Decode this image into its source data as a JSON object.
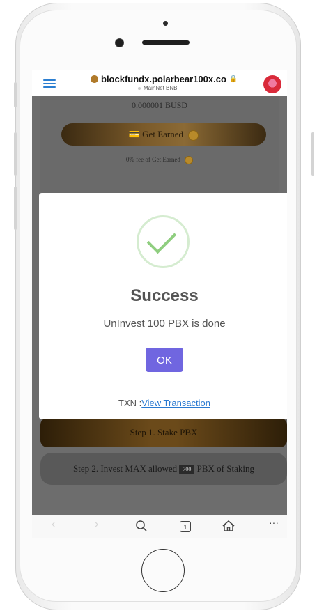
{
  "browser": {
    "url": "blockfundx.polarbear100x.co",
    "network": "MainNet BNB"
  },
  "page": {
    "balance": "0.000001 BUSD",
    "get_earned_label": "Get Earned",
    "fee_text": "0% fee of Get Earned",
    "step1_label": "Step 1. Stake PBX",
    "step2_prefix": "Step 2. Invest MAX allowed",
    "step2_amount": "700",
    "step2_suffix": "PBX of Staking"
  },
  "modal": {
    "title": "Success",
    "message": "UnInvest 100 PBX is done",
    "ok_label": "OK",
    "txn_label": "TXN :",
    "txn_link": "View Transaction"
  },
  "bottom_nav": {
    "tab_count": "1",
    "back_icon": "chevron-left-icon",
    "forward_icon": "chevron-right-icon",
    "search_icon": "search-icon",
    "home_icon": "home-icon",
    "more_icon": "more-icon"
  },
  "colors": {
    "ok_button": "#7066e0",
    "success_check": "#8fce7f",
    "link": "#2a7ad1"
  }
}
